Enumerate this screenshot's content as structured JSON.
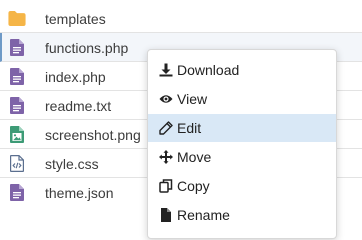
{
  "files": [
    {
      "name": "templates",
      "icon": "folder-icon"
    },
    {
      "name": "functions.php",
      "icon": "document-icon"
    },
    {
      "name": "index.php",
      "icon": "document-icon"
    },
    {
      "name": "readme.txt",
      "icon": "document-icon"
    },
    {
      "name": "screenshot.png",
      "icon": "image-file-icon"
    },
    {
      "name": "style.css",
      "icon": "code-file-icon"
    },
    {
      "name": "theme.json",
      "icon": "document-icon"
    }
  ],
  "context_menu": {
    "items": [
      {
        "label": "Download",
        "icon": "download-icon"
      },
      {
        "label": "View",
        "icon": "eye-icon"
      },
      {
        "label": "Edit",
        "icon": "pencil-icon"
      },
      {
        "label": "Move",
        "icon": "move-icon"
      },
      {
        "label": "Copy",
        "icon": "copy-icon"
      },
      {
        "label": "Rename",
        "icon": "rename-icon"
      }
    ]
  },
  "colors": {
    "folder": "#f5b547",
    "document": "#7e63a8",
    "image_file": "#3d9b76",
    "code_file": "#5b6f8f",
    "menu_active": "#d9e8f6"
  }
}
